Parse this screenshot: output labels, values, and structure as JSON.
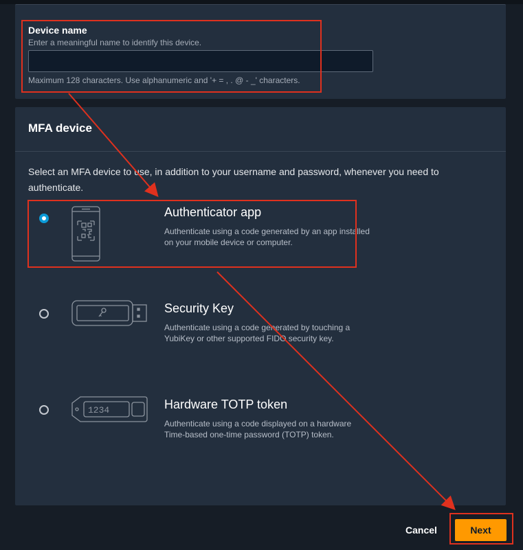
{
  "device_name": {
    "label": "Device name",
    "hint": "Enter a meaningful name to identify this device.",
    "value": "",
    "constraint": "Maximum 128 characters. Use alphanumeric and '+ = , . @ - _' characters."
  },
  "mfa_device": {
    "title": "MFA device",
    "description": "Select an MFA device to use, in addition to your username and password, whenever you need to authenticate.",
    "options": [
      {
        "title": "Authenticator app",
        "description": "Authenticate using a code generated by an app installed on your mobile device or computer.",
        "selected": true,
        "icon": "phone-qr-icon"
      },
      {
        "title": "Security Key",
        "description": "Authenticate using a code generated by touching a YubiKey or other supported FIDO security key.",
        "selected": false,
        "icon": "usb-key-icon"
      },
      {
        "title": "Hardware TOTP token",
        "description": "Authenticate using a code displayed on a hardware Time-based one-time password (TOTP) token.",
        "selected": false,
        "icon": "totp-token-icon",
        "token_display": "1234"
      }
    ]
  },
  "actions": {
    "cancel_label": "Cancel",
    "next_label": "Next"
  },
  "colors": {
    "accent": "#ff9900",
    "radio_selected": "#0b9bd8",
    "annotation": "#e0311e",
    "panel": "#232f3e"
  }
}
